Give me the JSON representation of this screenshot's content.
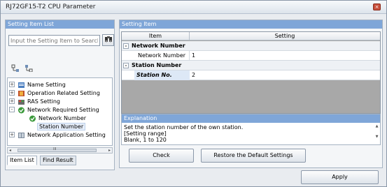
{
  "window": {
    "title": "RJ72GF15-T2 CPU Parameter",
    "close_glyph": "×"
  },
  "left_panel": {
    "header": "Setting Item List",
    "search_placeholder": "Input the Setting Item to Search",
    "search_icon": "binoculars-icon",
    "toolbar_icons": [
      "expand-all-icon",
      "collapse-all-icon"
    ],
    "tree": [
      {
        "label": "Name Setting",
        "expander": "+",
        "icon": "name-setting-icon"
      },
      {
        "label": "Operation Related Setting",
        "expander": "+",
        "icon": "operation-icon"
      },
      {
        "label": "RAS Setting",
        "expander": "+",
        "icon": "ras-icon"
      },
      {
        "label": "Network Required Setting",
        "expander": "-",
        "icon": "check-icon"
      },
      {
        "label": "Network Number",
        "icon": "check-icon"
      },
      {
        "label": "Station Number",
        "icon": ""
      },
      {
        "label": "Network Application Setting",
        "expander": "+",
        "icon": "network-app-icon"
      }
    ],
    "scroll_mid": "III",
    "tabs": [
      "Item List",
      "Find Result"
    ]
  },
  "right_panel": {
    "header": "Setting Item",
    "grid_headers": {
      "item": "Item",
      "setting": "Setting"
    },
    "rows": [
      {
        "category": "Network Number",
        "expander": "-"
      },
      {
        "item": "Network Number",
        "value": "1"
      },
      {
        "category": "Station Number",
        "expander": "-"
      },
      {
        "item": "Station No.",
        "value": "2"
      }
    ],
    "explanation": {
      "header": "Explanation",
      "lines": [
        "Set the station number of the own station.",
        "[Setting range]",
        "Blank, 1 to 120"
      ]
    },
    "check_button": "Check",
    "restore_button": "Restore the Default Settings"
  },
  "footer": {
    "apply_button": "Apply"
  }
}
